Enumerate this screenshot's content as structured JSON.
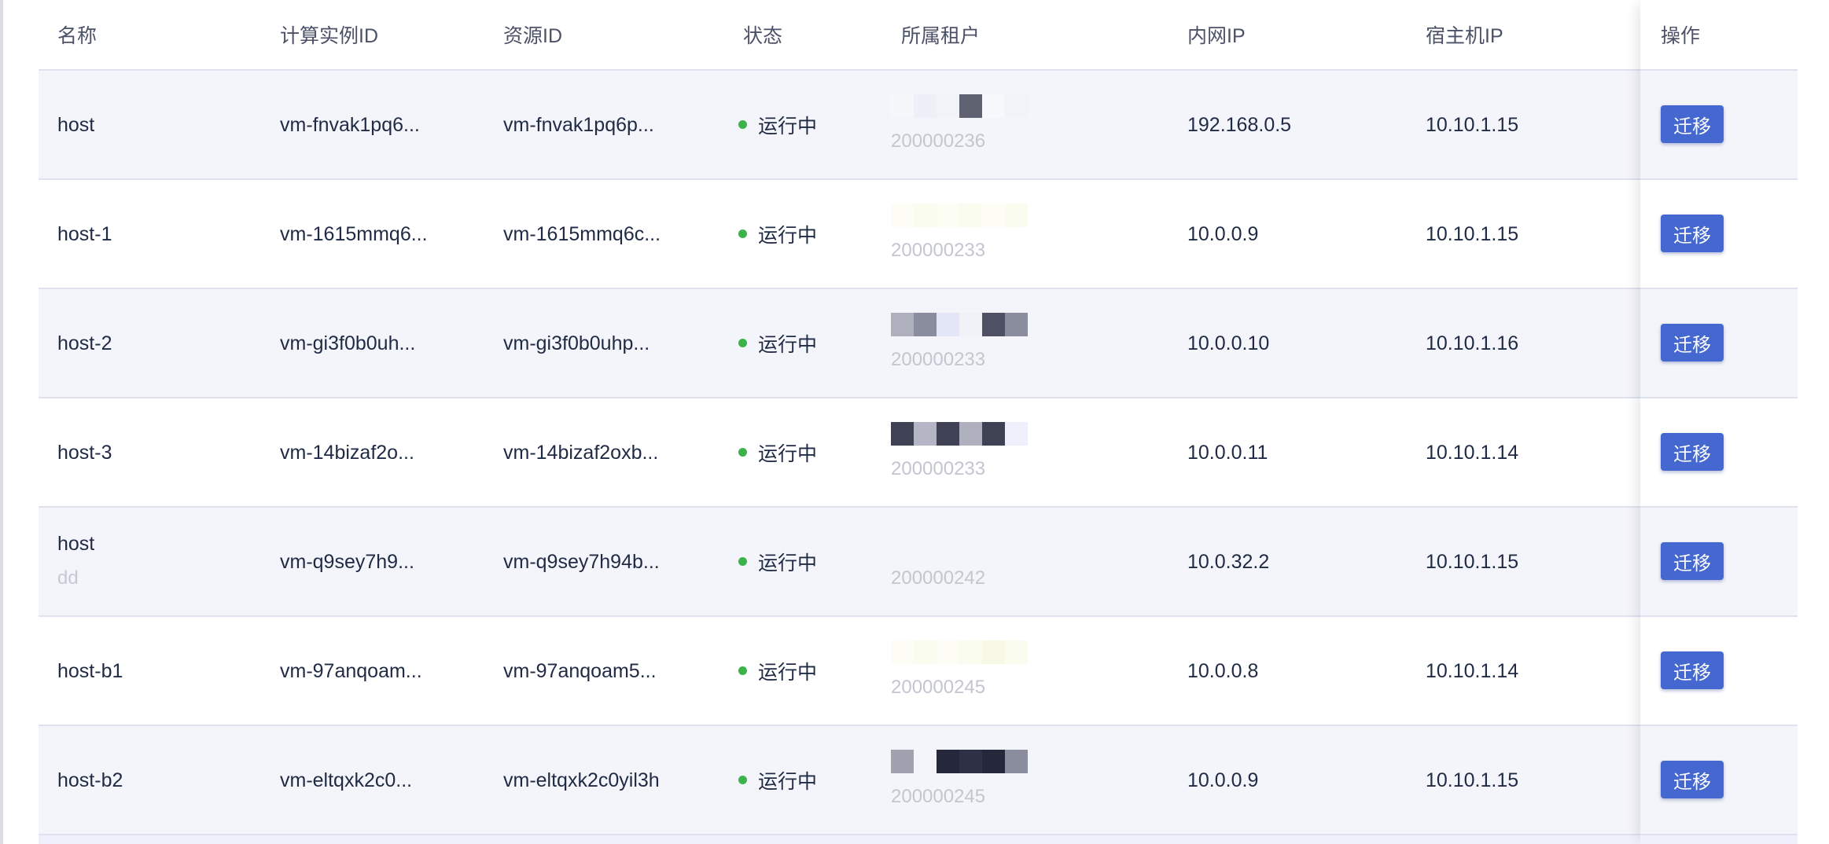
{
  "table": {
    "columns": [
      "名称",
      "计算实例ID",
      "资源ID",
      "状态",
      "所属租户",
      "内网IP",
      "宿主机IP",
      "操作"
    ],
    "rows": [
      {
        "name": "host",
        "name_sub": "",
        "instance_id": "vm-fnvak1pq6...",
        "resource_id": "vm-fnvak1pq6p...",
        "status": "运行中",
        "tenant_id": "200000236",
        "private_ip": "192.168.0.5",
        "host_ip": "10.10.1.15",
        "action": "迁移"
      },
      {
        "name": "host-1",
        "name_sub": "",
        "instance_id": "vm-1615mmq6...",
        "resource_id": "vm-1615mmq6c...",
        "status": "运行中",
        "tenant_id": "200000233",
        "private_ip": "10.0.0.9",
        "host_ip": "10.10.1.15",
        "action": "迁移"
      },
      {
        "name": "host-2",
        "name_sub": "",
        "instance_id": "vm-gi3f0b0uh...",
        "resource_id": "vm-gi3f0b0uhp...",
        "status": "运行中",
        "tenant_id": "200000233",
        "private_ip": "10.0.0.10",
        "host_ip": "10.10.1.16",
        "action": "迁移"
      },
      {
        "name": "host-3",
        "name_sub": "",
        "instance_id": "vm-14bizaf2o...",
        "resource_id": "vm-14bizaf2oxb...",
        "status": "运行中",
        "tenant_id": "200000233",
        "private_ip": "10.0.0.11",
        "host_ip": "10.10.1.14",
        "action": "迁移"
      },
      {
        "name": "host",
        "name_sub": "dd",
        "instance_id": "vm-q9sey7h9...",
        "resource_id": "vm-q9sey7h94b...",
        "status": "运行中",
        "tenant_id": "200000242",
        "private_ip": "10.0.32.2",
        "host_ip": "10.10.1.15",
        "action": "迁移"
      },
      {
        "name": "host-b1",
        "name_sub": "",
        "instance_id": "vm-97anqoam...",
        "resource_id": "vm-97anqoam5...",
        "status": "运行中",
        "tenant_id": "200000245",
        "private_ip": "10.0.0.8",
        "host_ip": "10.10.1.14",
        "action": "迁移"
      },
      {
        "name": "host-b2",
        "name_sub": "",
        "instance_id": "vm-eltqxk2c0...",
        "resource_id": "vm-eltqxk2c0yil3h",
        "status": "运行中",
        "tenant_id": "200000245",
        "private_ip": "10.0.0.9",
        "host_ip": "10.10.1.15",
        "action": "迁移"
      }
    ]
  },
  "colors": {
    "status_running": "#3bb34a",
    "button_primary": "#4468d0",
    "row_alt": "#f4f5fa",
    "divider": "#dfe2ee"
  },
  "icons": {
    "status": "status-dot-icon"
  }
}
